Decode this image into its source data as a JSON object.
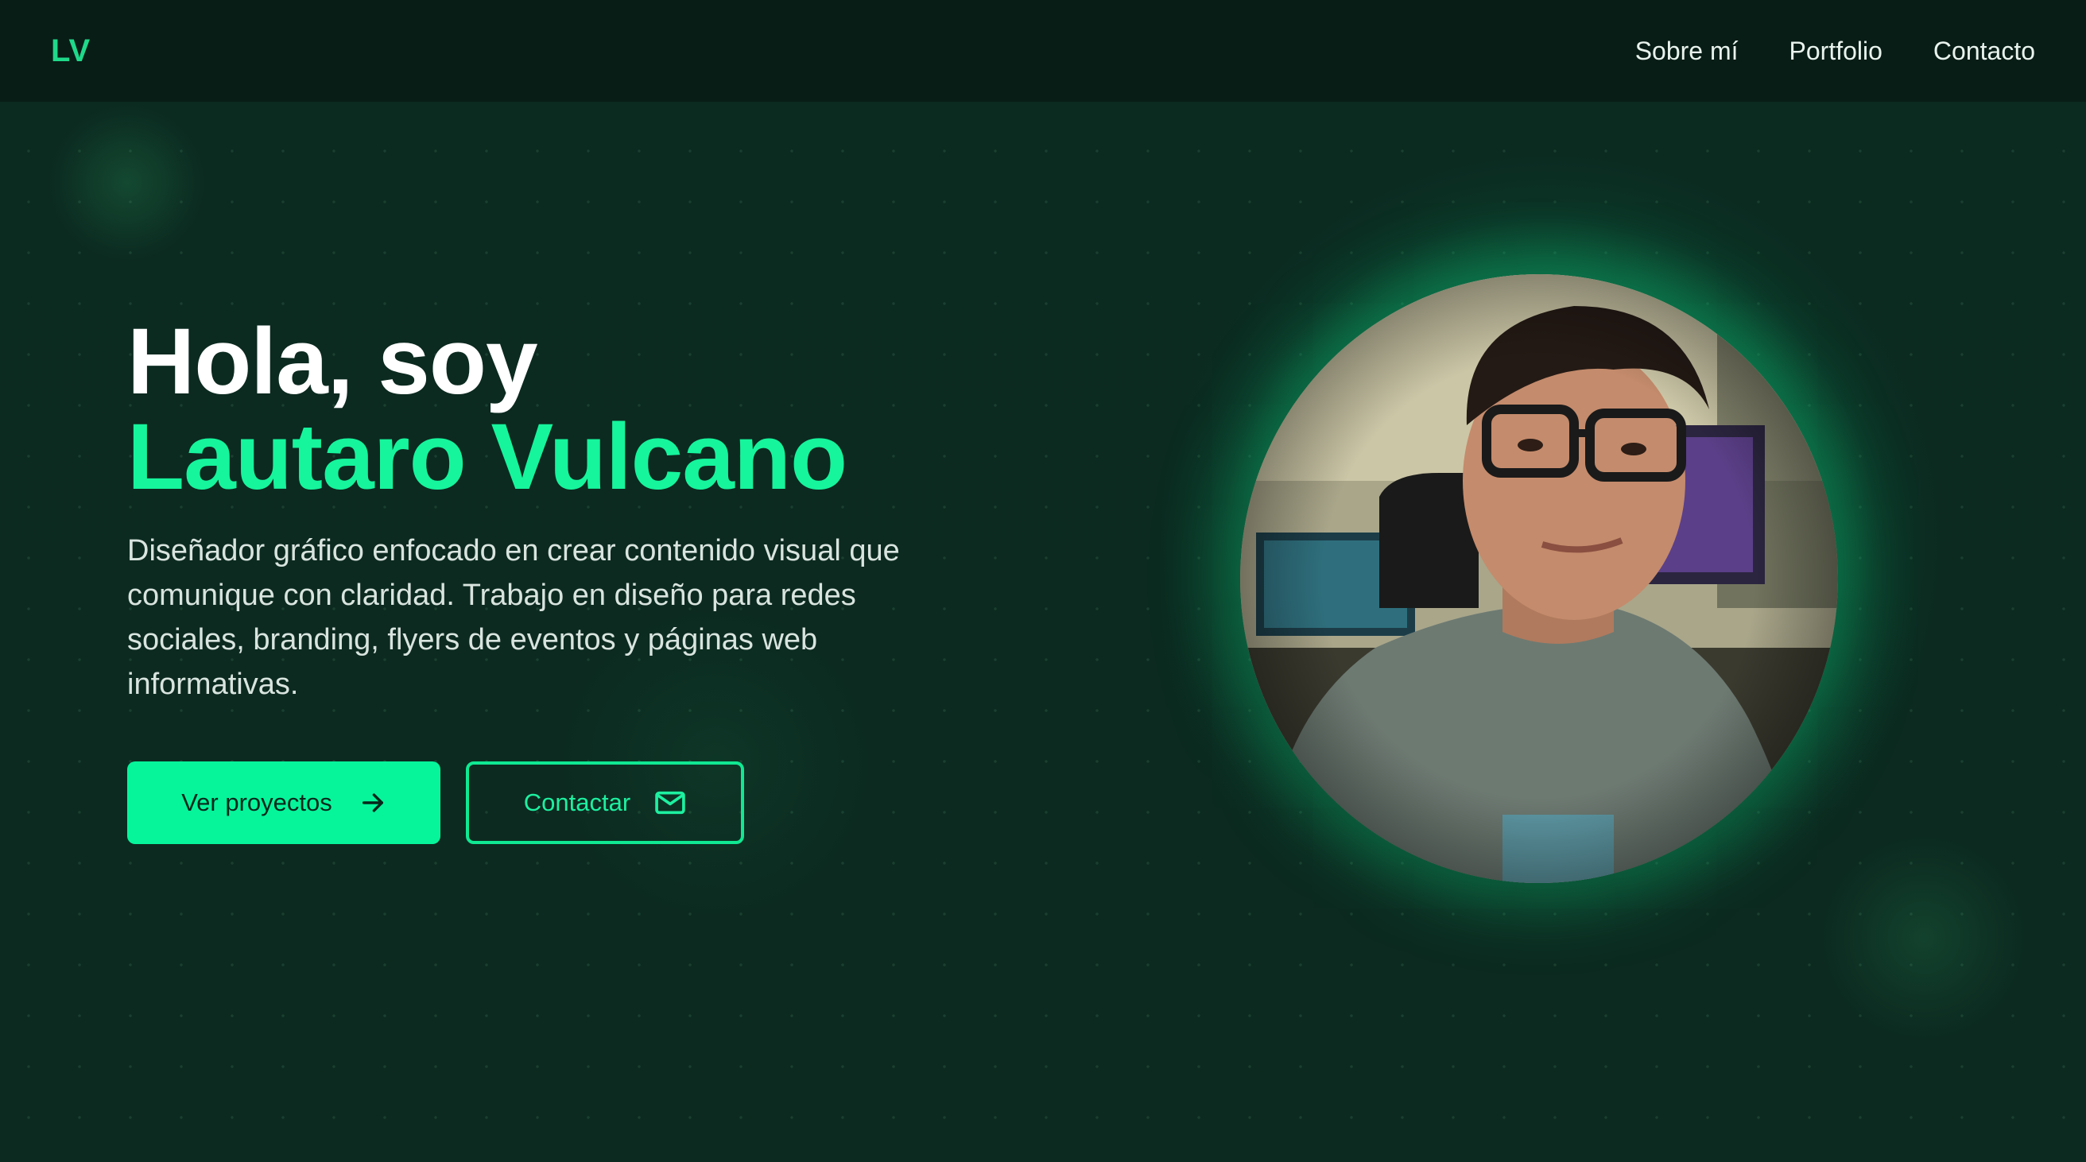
{
  "header": {
    "logo": "LV",
    "nav": [
      {
        "label": "Sobre mí"
      },
      {
        "label": "Portfolio"
      },
      {
        "label": "Contacto"
      }
    ]
  },
  "hero": {
    "greeting": "Hola, soy",
    "name": "Lautaro Vulcano",
    "description": "Diseñador gráfico enfocado en crear contenido visual que comunique con claridad. Trabajo en diseño para redes sociales, branding, flyers de eventos y páginas web informativas.",
    "primary_button": {
      "label": "Ver proyectos",
      "icon": "arrow-right-icon"
    },
    "secondary_button": {
      "label": "Contactar",
      "icon": "mail-icon"
    }
  },
  "profile": {
    "photo": "profile-photo"
  },
  "colors": {
    "background": "#0b2a20",
    "header": "#081d16",
    "accent": "#06f59b",
    "text": "#ffffff"
  }
}
